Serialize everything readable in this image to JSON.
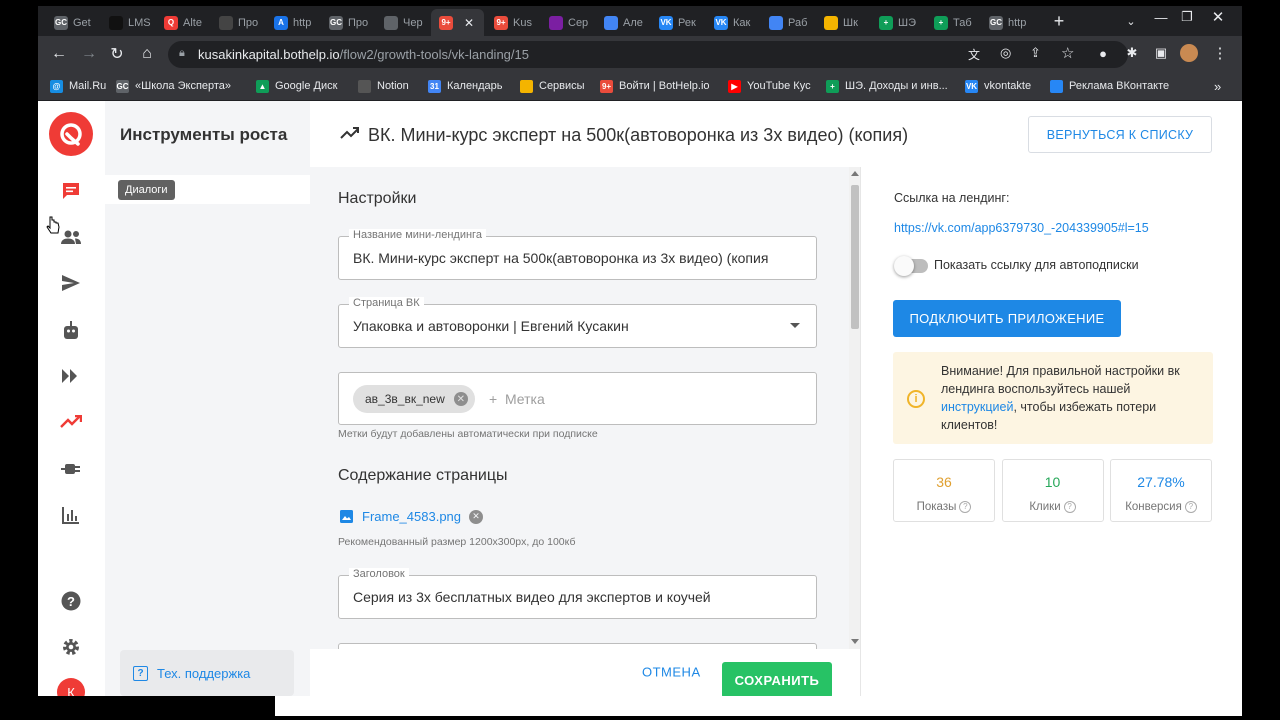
{
  "browser": {
    "tabs": [
      {
        "label": "Get",
        "fav": "GC",
        "color": "#5f6368"
      },
      {
        "label": "LMS",
        "fav": "",
        "color": "#111"
      },
      {
        "label": "Alte",
        "fav": "Q",
        "color": "#ef3b36"
      },
      {
        "label": "Про",
        "fav": "",
        "color": "#444"
      },
      {
        "label": "http",
        "fav": "A",
        "color": "#1a73e8"
      },
      {
        "label": "Про",
        "fav": "GC",
        "color": "#5f6368"
      },
      {
        "label": "Чер",
        "fav": "",
        "color": "#5f6368"
      },
      {
        "label": "",
        "fav": "9+",
        "color": "#ea4c3c"
      },
      {
        "label": "Kus",
        "fav": "9+",
        "color": "#ea4c3c"
      },
      {
        "label": "Сер",
        "fav": "",
        "color": "#7b1fa2"
      },
      {
        "label": "Але",
        "fav": "",
        "color": "#4285f4"
      },
      {
        "label": "Рек",
        "fav": "VK",
        "color": "#2787f5"
      },
      {
        "label": "Как",
        "fav": "VK",
        "color": "#2787f5"
      },
      {
        "label": "Раб",
        "fav": "",
        "color": "#4285f4"
      },
      {
        "label": "Шк",
        "fav": "",
        "color": "#f4b400"
      },
      {
        "label": "ШЭ",
        "fav": "+",
        "color": "#0f9d58"
      },
      {
        "label": "Таб",
        "fav": "+",
        "color": "#0f9d58"
      },
      {
        "label": "http",
        "fav": "GC",
        "color": "#5f6368"
      }
    ],
    "url_host": "kusakinkapital.bothelp.io",
    "url_path": "/flow2/growth-tools/vk-landing/15",
    "bookmarks": [
      {
        "label": "Mail.Ru",
        "fav": "@",
        "color": "#168de2"
      },
      {
        "label": "«Школа Эксперта»",
        "fav": "GC",
        "color": "#5f6368"
      },
      {
        "label": "Google Диск",
        "fav": "▲",
        "color": "#0f9d58"
      },
      {
        "label": "Notion",
        "fav": "",
        "color": "#555"
      },
      {
        "label": "Календарь",
        "fav": "31",
        "color": "#4285f4"
      },
      {
        "label": "Сервисы",
        "fav": "",
        "color": "#f4b400"
      },
      {
        "label": "Войти | BotHelp.io",
        "fav": "9+",
        "color": "#ea4c3c"
      },
      {
        "label": "YouTube Кус",
        "fav": "▶",
        "color": "#ff0000"
      },
      {
        "label": "ШЭ. Доходы и инв...",
        "fav": "+",
        "color": "#0f9d58"
      },
      {
        "label": "vkontakte",
        "fav": "VK",
        "color": "#2787f5"
      },
      {
        "label": "Реклама ВКонтакте",
        "fav": "",
        "color": "#2787f5"
      }
    ]
  },
  "sidebar": {
    "title": "Инструменты роста",
    "tooltip": "Диалоги",
    "support": "Тех. поддержка",
    "avatar_letter": "К"
  },
  "header": {
    "title": "ВК. Мини-курс эксперт на 500к(автоворонка из 3х видео) (копия)",
    "back_button": "ВЕРНУТЬСЯ К СПИСКУ"
  },
  "form": {
    "settings_title": "Настройки",
    "name_label": "Название мини-лендинга",
    "name_value": "ВК. Мини-курс эксперт на 500к(автоворонка из 3х видео) (копия",
    "vk_page_label": "Страница ВК",
    "vk_page_value": "Упаковка и автоворонки | Евгений Кусакин",
    "tag_chip": "ав_3в_вк_new",
    "tag_placeholder": "+  Метка",
    "tag_hint": "Метки будут добавлены автоматически при подписке",
    "content_title": "Содержание страницы",
    "file_name": "Frame_4583.png",
    "file_hint": "Рекомендованный размер 1200x300px, до 100кб",
    "heading_label": "Заголовок",
    "heading_value": "Серия из 3х бесплатных видео для экспертов и коучей"
  },
  "footer": {
    "cancel": "ОТМЕНА",
    "save": "СОХРАНИТЬ"
  },
  "right": {
    "link_label": "Ссылка на лендинг:",
    "link_url": "https://vk.com/app6379730_-204339905#l=15",
    "toggle_label": "Показать ссылку для автоподписки",
    "toggle_on": false,
    "connect_button": "ПОДКЛЮЧИТЬ ПРИЛОЖЕНИЕ",
    "warning_pre": "Внимание! Для правильной настройки вк лендинга воспользуйтесь нашей ",
    "warning_link": "инструкцией",
    "warning_post": ", чтобы избежать потери клиентов!",
    "stats": [
      {
        "value": "36",
        "caption": "Показы",
        "color": "#e0a030"
      },
      {
        "value": "10",
        "caption": "Клики",
        "color": "#27a85a"
      },
      {
        "value": "27.78%",
        "caption": "Конверсия",
        "color": "#1e88e5"
      }
    ]
  }
}
